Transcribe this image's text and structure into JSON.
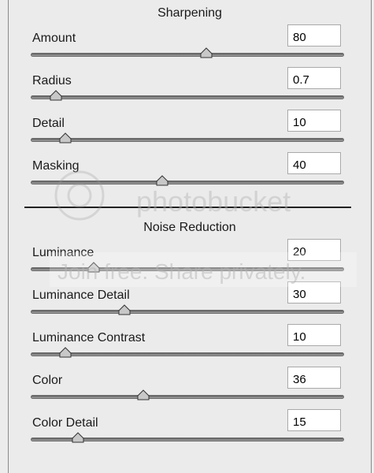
{
  "sharpening": {
    "title": "Sharpening",
    "sliders": [
      {
        "label": "Amount",
        "value": "80",
        "position": 0.56
      },
      {
        "label": "Radius",
        "value": "0.7",
        "position": 0.08
      },
      {
        "label": "Detail",
        "value": "10",
        "position": 0.11
      },
      {
        "label": "Masking",
        "value": "40",
        "position": 0.42
      }
    ]
  },
  "noise_reduction": {
    "title": "Noise Reduction",
    "sliders": [
      {
        "label": "Luminance",
        "value": "20",
        "position": 0.2
      },
      {
        "label": "Luminance Detail",
        "value": "30",
        "position": 0.3
      },
      {
        "label": "Luminance Contrast",
        "value": "10",
        "position": 0.11
      },
      {
        "label": "Color",
        "value": "36",
        "position": 0.36
      },
      {
        "label": "Color Detail",
        "value": "15",
        "position": 0.15
      }
    ]
  },
  "watermark": {
    "brand": "photobucket",
    "tagline": "Join free. Share privately."
  },
  "colors": {
    "panel_bg": "#ebebeb",
    "track": "#7a7a7a",
    "thumb": "#c8c8c8"
  },
  "icons": {
    "slider_thumb": "triangle-slider-thumb-icon"
  }
}
